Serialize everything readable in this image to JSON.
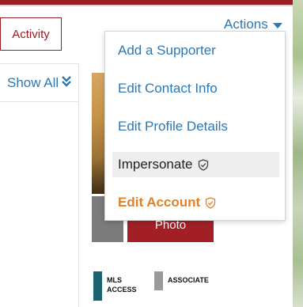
{
  "tabs": {
    "activity": "Activity"
  },
  "header": {
    "actions_label": "Actions"
  },
  "sidebar": {
    "show_all": "Show All"
  },
  "profile": {
    "photo_button": "Photo"
  },
  "tags": [
    {
      "line1": "MLS",
      "line2": "ACCESS",
      "color": "#1a6470"
    },
    {
      "line1": "ASSOCIATE",
      "color": "#9a9a9a"
    }
  ],
  "actions_menu": {
    "items": [
      {
        "label": "Add a Supporter"
      },
      {
        "label": "Edit Contact Info"
      },
      {
        "label": "Edit Profile Details"
      },
      {
        "label": "Impersonate",
        "icon": "shield-check-icon"
      },
      {
        "label": "Edit Account",
        "icon": "shield-check-icon"
      }
    ]
  },
  "colors": {
    "brand": "#9b1c22",
    "link": "#2b78b5",
    "accent_orange": "#e0802a"
  }
}
